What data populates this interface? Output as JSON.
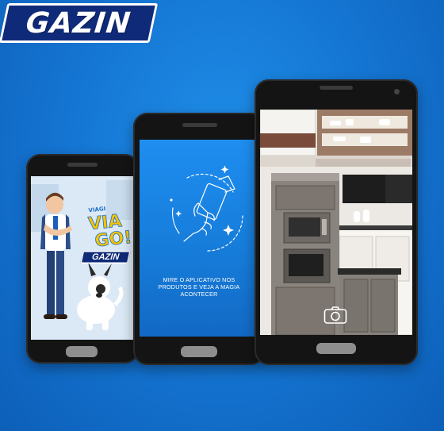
{
  "brand": {
    "logo_text": "GAZIN",
    "color": "#0f2a78"
  },
  "phone_left": {
    "promo_badge_text": "GAZIN",
    "promo_headline": "VIAGI GO!"
  },
  "phone_middle": {
    "instruction_text": "MIRE O APLICATIVO NOS PRODUTOS E VEJA A MAGIA ACONTECER",
    "icon": "phone-scan-icon"
  },
  "phone_right": {
    "scene": "kitchen-ar-preview",
    "button_icon": "camera-icon"
  },
  "colors": {
    "background": "#1577d4",
    "screen_blue": "#1e8ef0"
  }
}
